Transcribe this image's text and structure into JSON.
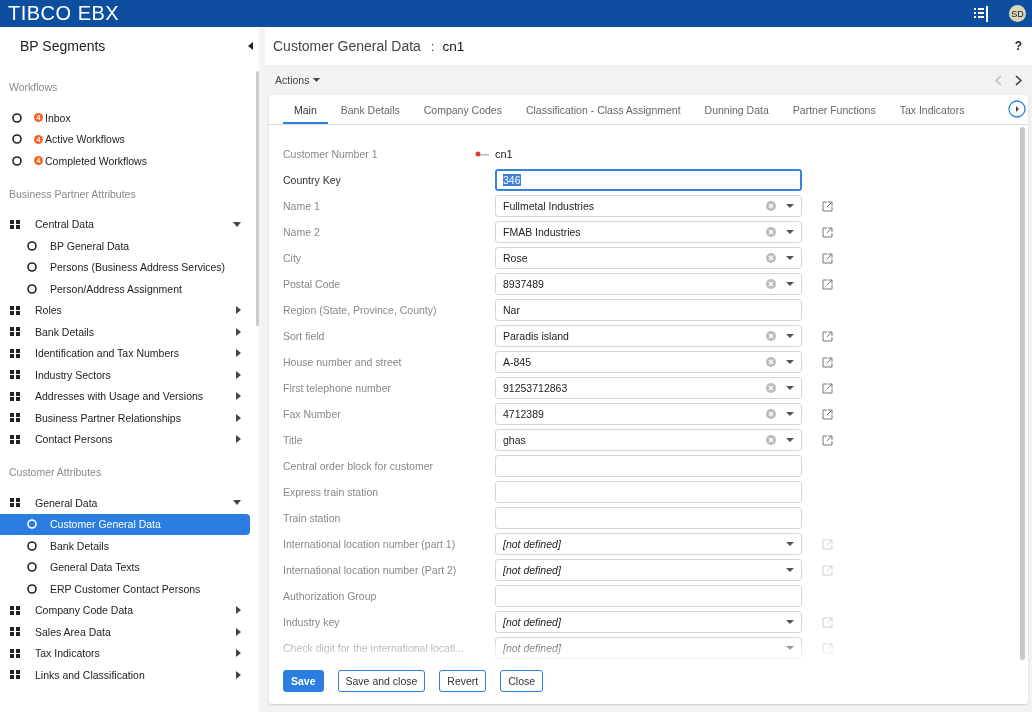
{
  "app": {
    "brand": "TIBCO EBX",
    "user_initials": "SD"
  },
  "sidebar": {
    "title": "BP Segments",
    "sections": [
      {
        "heading": "Workflows",
        "items": [
          {
            "kind": "workflow",
            "label": "Inbox",
            "badge": "4",
            "selected": false
          },
          {
            "kind": "workflow",
            "label": "Active Workflows",
            "badge": "4",
            "selected": false
          },
          {
            "kind": "workflow",
            "label": "Completed Workflows",
            "badge": "4",
            "selected": false
          }
        ]
      },
      {
        "heading": "Business Partner Attributes",
        "items": [
          {
            "kind": "group",
            "label": "Central Data",
            "expanded": true,
            "selected": false,
            "children": [
              {
                "kind": "leaf",
                "label": "BP General Data",
                "selected": false
              },
              {
                "kind": "leaf",
                "label": "Persons (Business Address Services)",
                "selected": false
              },
              {
                "kind": "leaf",
                "label": "Person/Address Assignment",
                "selected": false
              }
            ]
          },
          {
            "kind": "group",
            "label": "Roles",
            "expanded": false,
            "selected": false
          },
          {
            "kind": "group",
            "label": "Bank Details",
            "expanded": false,
            "selected": false
          },
          {
            "kind": "group",
            "label": "Identification and Tax Numbers",
            "expanded": false,
            "selected": false
          },
          {
            "kind": "group",
            "label": "Industry Sectors",
            "expanded": false,
            "selected": false
          },
          {
            "kind": "group",
            "label": "Addresses with Usage and Versions",
            "expanded": false,
            "selected": false
          },
          {
            "kind": "group",
            "label": "Business Partner Relationships",
            "expanded": false,
            "selected": false
          },
          {
            "kind": "group",
            "label": "Contact Persons",
            "expanded": false,
            "selected": false
          }
        ]
      },
      {
        "heading": "Customer Attributes",
        "items": [
          {
            "kind": "group",
            "label": "General Data",
            "expanded": true,
            "selected": false,
            "children": [
              {
                "kind": "leaf",
                "label": "Customer General Data",
                "selected": true
              },
              {
                "kind": "leaf",
                "label": "Bank Details",
                "selected": false
              },
              {
                "kind": "leaf",
                "label": "General Data Texts",
                "selected": false
              },
              {
                "kind": "leaf",
                "label": "ERP Customer Contact Persons",
                "selected": false
              }
            ]
          },
          {
            "kind": "group",
            "label": "Company Code Data",
            "expanded": false,
            "selected": false
          },
          {
            "kind": "group",
            "label": "Sales Area Data",
            "expanded": false,
            "selected": false
          },
          {
            "kind": "group",
            "label": "Tax Indicators",
            "expanded": false,
            "selected": false
          },
          {
            "kind": "group",
            "label": "Links and Classification",
            "expanded": false,
            "selected": false
          }
        ]
      }
    ]
  },
  "page": {
    "title": "Customer General Data",
    "separator": ":",
    "record": "cn1",
    "help": "?",
    "actions": "Actions"
  },
  "tabs": [
    {
      "label": "Main",
      "selected": true
    },
    {
      "label": "Bank Details",
      "selected": false
    },
    {
      "label": "Company Codes",
      "selected": false
    },
    {
      "label": "Classification - Class Assignment",
      "selected": false
    },
    {
      "label": "Dunning Data",
      "selected": false
    },
    {
      "label": "Partner Functions",
      "selected": false
    },
    {
      "label": "Tax Indicators",
      "selected": false
    }
  ],
  "fields": [
    {
      "kind": "readonly",
      "label": "Customer Number 1",
      "value": "cn1",
      "focused": false
    },
    {
      "kind": "text",
      "label": "Country Key",
      "value": "346",
      "focused": true
    },
    {
      "kind": "combo",
      "label": "Name 1",
      "value": "Fullmetal Industries",
      "focused": false
    },
    {
      "kind": "combo",
      "label": "Name 2",
      "value": "FMAB Industries",
      "focused": false
    },
    {
      "kind": "combo",
      "label": "City",
      "value": "Rose",
      "focused": false
    },
    {
      "kind": "combo",
      "label": "Postal Code",
      "value": "8937489",
      "focused": false
    },
    {
      "kind": "text",
      "label": "Region (State, Province, County)",
      "value": "Nar",
      "focused": false
    },
    {
      "kind": "combo",
      "label": "Sort field",
      "value": "Paradis island",
      "focused": false
    },
    {
      "kind": "combo",
      "label": "House number and street",
      "value": "A-845",
      "focused": false
    },
    {
      "kind": "combo",
      "label": "First telephone number",
      "value": "91253712863",
      "focused": false
    },
    {
      "kind": "combo",
      "label": "Fax Number",
      "value": "4712389",
      "focused": false
    },
    {
      "kind": "combo",
      "label": "Title",
      "value": "ghas",
      "focused": false
    },
    {
      "kind": "text",
      "label": "Central order block for customer",
      "focused": false
    },
    {
      "kind": "text",
      "label": "Express train station",
      "focused": false
    },
    {
      "kind": "text",
      "label": "Train station",
      "focused": false
    },
    {
      "kind": "select",
      "label": "International location number (part 1)",
      "value": "[not defined]",
      "focused": false
    },
    {
      "kind": "select",
      "label": "International location number (Part 2)",
      "value": "[not defined]",
      "focused": false
    },
    {
      "kind": "text",
      "label": "Authorization Group",
      "focused": false
    },
    {
      "kind": "select",
      "label": "Industry key",
      "value": "[not defined]",
      "focused": false
    },
    {
      "kind": "select",
      "label": "Check digit for the international locati...",
      "value": "[not defined]",
      "focused": false
    }
  ],
  "buttons": [
    {
      "label": "Save",
      "kind": "primary"
    },
    {
      "label": "Save and close",
      "kind": "secondary"
    },
    {
      "label": "Revert",
      "kind": "secondary"
    },
    {
      "label": "Close",
      "kind": "secondary"
    }
  ]
}
